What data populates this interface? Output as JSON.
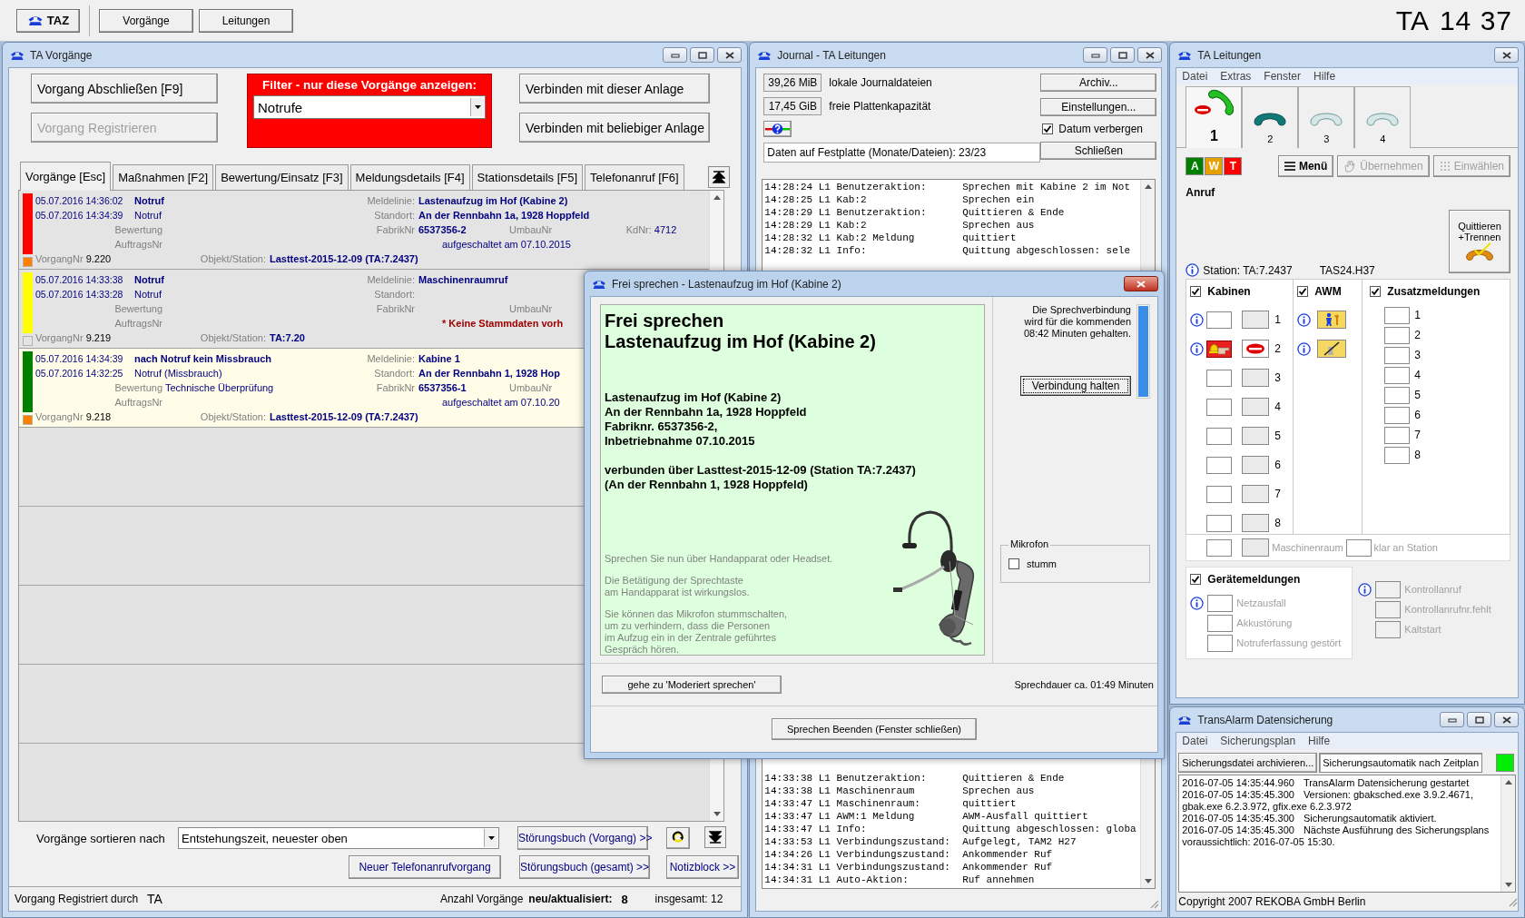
{
  "top_bar": {
    "app_button": "TAZ",
    "nav_buttons": [
      {
        "label": "Vorgänge"
      },
      {
        "label": "Leitungen"
      }
    ],
    "clock_label": "TA",
    "clock_time": "14 37"
  },
  "vorgaenge": {
    "title": "TA Vorgänge",
    "action_buttons": [
      {
        "label": "Vorgang Abschließen [F9]",
        "disabled": false
      },
      {
        "label": "Vorgang Registrieren",
        "disabled": true
      }
    ],
    "filter": {
      "title": "Filter - nur diese Vorgänge anzeigen:",
      "value": "Notrufe"
    },
    "connect_buttons": [
      {
        "label": "Verbinden mit dieser Anlage"
      },
      {
        "label": "Verbinden mit beliebiger Anlage"
      }
    ],
    "tabs": [
      {
        "label": "Vorgänge [Esc]",
        "selected": true
      },
      {
        "label": "Maßnahmen [F2]",
        "selected": false
      },
      {
        "label": "Bewertung/Einsatz [F3]",
        "selected": false
      },
      {
        "label": "Meldungsdetails [F4]",
        "selected": false
      },
      {
        "label": "Stationsdetails [F5]",
        "selected": false
      },
      {
        "label": "Telefonanruf [F6]",
        "selected": false
      }
    ],
    "rows": [
      {
        "color": "#ff0000",
        "marker": {
          "color": "#ff8000"
        },
        "selected": false,
        "time_1": "05.07.2016 14:36:02",
        "event_1": "Notruf",
        "time_2": "05.07.2016 14:34:39",
        "event_2": "Notruf",
        "bewertung_label": "Bewertung",
        "auftrag_label": "AuftragsNr",
        "vorgang_label": "VorgangNr",
        "vorgang": "9.220",
        "objekt_label": "Objekt/Station:",
        "objekt": "Lasttest-2015-12-09 (TA:7.2437)",
        "meldelinie_label": "Meldelinie:",
        "meldelinie": "Lastenaufzug im Hof (Kabine 2)",
        "standort_label": "Standort:",
        "standort": "An der Rennbahn 1a, 1928 Hoppfeld",
        "fabrik_label": "FabrikNr",
        "fabrik": "6537356-2",
        "umbau_label": "UmbauNr",
        "kd_label": "KdNr:",
        "kd": "4712",
        "aufgeschaltet": "aufgeschaltet am 07.10.2015"
      },
      {
        "color": "#ffff00",
        "marker": {
          "color": "#e4e4e4"
        },
        "selected": false,
        "time_1": "05.07.2016 14:33:38",
        "event_1": "Notruf",
        "time_2": "05.07.2016 14:33:28",
        "event_2": "Notruf",
        "bewertung_label": "Bewertung",
        "auftrag_label": "AuftragsNr",
        "vorgang_label": "VorgangNr",
        "vorgang": "9.219",
        "objekt_label": "Objekt/Station:",
        "objekt": "TA:7.20",
        "meldelinie_label": "Meldelinie:",
        "meldelinie": "Maschinenraumruf",
        "standort_label": "Standort:",
        "fabrik_label": "FabrikNr",
        "umbau_label": "UmbauNr",
        "note": "* Keine Stammdaten vorh"
      },
      {
        "color": "#008000",
        "marker": {
          "color": "#ff8000"
        },
        "selected": true,
        "time_1": "05.07.2016 14:34:39",
        "event_1": "nach Notruf kein Missbrauch",
        "time_2": "05.07.2016 14:32:25",
        "event_2": "Notruf (Missbrauch)",
        "bewertung_label": "Bewertung",
        "bewertung": "Technische Überprüfung",
        "auftrag_label": "AuftragsNr",
        "vorgang_label": "VorgangNr",
        "vorgang": "9.218",
        "objekt_label": "Objekt/Station:",
        "objekt": "Lasttest-2015-12-09 (TA:7.2437)",
        "meldelinie_label": "Meldelinie:",
        "meldelinie": "Kabine 1",
        "standort_label": "Standort:",
        "standort": "An der Rennbahn 1, 1928 Hop",
        "fabrik_label": "FabrikNr",
        "fabrik": "6537356-1",
        "umbau_label": "UmbauNr",
        "aufgeschaltet": "aufgeschaltet am 07.10.20"
      }
    ],
    "sort": {
      "label": "Vorgänge sortieren nach",
      "value": "Entstehungszeit, neuester oben"
    },
    "buttons": {
      "stoerungsbuch_vorgang": "Störungsbuch (Vorgang) >>",
      "neuer_anruf": "Neuer Telefonanrufvorgang",
      "stoerungsbuch_gesamt": "Störungsbuch (gesamt) >>",
      "notizblock": "Notizblock >>"
    },
    "status_bar": {
      "registered_label": "Vorgang Registriert durch",
      "registered_by": "TA",
      "count_label": "Anzahl Vorgänge",
      "new_label": "neu/aktualisiert:",
      "new_count": "8",
      "total": "insgesamt: 12"
    }
  },
  "journal": {
    "title": "Journal - TA Leitungen",
    "stats": [
      {
        "value": "39,26 MiB",
        "label": "lokale Journaldateien"
      },
      {
        "value": "17,45 GiB",
        "label": "freie Plattenkapazität"
      }
    ],
    "storage_info": "Daten auf Festplatte (Monate/Dateien): 23/23",
    "buttons": [
      "Archiv...",
      "Einstellungen..."
    ],
    "hide_date": {
      "label": "Datum verbergen",
      "checked": true
    },
    "close_button": "Schließen",
    "log_top": [
      {
        "entry": "14:28:24 L1 Benutzeraktion:",
        "detail": "Sprechen mit Kabine 2 im Not"
      },
      {
        "entry": "14:28:25 L1 Kab:2",
        "detail": "Sprechen ein"
      },
      {
        "entry": "14:28:29 L1 Benutzeraktion:",
        "detail": "Quittieren & Ende"
      },
      {
        "entry": "14:28:29 L1 Kab:2",
        "detail": "Sprechen aus"
      },
      {
        "entry": "14:28:32 L1 Kab:2 Meldung",
        "detail": "quittiert"
      },
      {
        "entry": "14:28:32 L1 Info:",
        "detail": "Quittung abgeschlossen: sele"
      }
    ],
    "log_bottom": [
      {
        "entry": "14:33:38 L1 Benutzeraktion:",
        "detail": "Quittieren & Ende"
      },
      {
        "entry": "14:33:38 L1 Maschinenraum",
        "detail": "Sprechen aus"
      },
      {
        "entry": "14:33:47 L1 Maschinenraum:",
        "detail": "quittiert"
      },
      {
        "entry": "14:33:47 L1 AWM:1 Meldung",
        "detail": "AWM-Ausfall quittiert"
      },
      {
        "entry": "14:33:47 L1 Info:",
        "detail": "Quittung abgeschlossen: globa"
      },
      {
        "entry": "14:33:53 L1 Verbindungszustand:",
        "detail": "Aufgelegt, TAM2 H27"
      },
      {
        "entry": "14:34:26 L1 Verbindungszustand:",
        "detail": "Ankommender Ruf"
      },
      {
        "entry": "14:34:31 L1 Verbindungszustand:",
        "detail": "Ankommender Ruf"
      },
      {
        "entry": "14:34:31 L1 Auto-Aktion:",
        "detail": "Ruf annehmen"
      }
    ]
  },
  "dialog": {
    "title": "Frei sprechen - Lastenaufzug im Hof (Kabine 2)",
    "heading": [
      "Frei sprechen",
      "Lastenaufzug im Hof (Kabine 2)"
    ],
    "details": [
      "Lastenaufzug im Hof (Kabine 2)",
      "An der Rennbahn 1a, 1928 Hoppfeld",
      "Fabriknr. 6537356-2,",
      "Inbetriebnahme 07.10.2015"
    ],
    "connection": [
      "verbunden über Lasttest-2015-12-09 (Station TA:7.2437)",
      "(An der Rennbahn 1, 1928 Hoppfeld)"
    ],
    "hints": [
      [
        "Sprechen Sie nun über Handapparat oder Headset."
      ],
      [
        "Die Betätigung der Sprechtaste",
        "am Handapparat ist wirkungslos."
      ],
      [
        "Sie können das Mikrofon stummschalten,",
        "um zu verhindern, dass die Personen",
        "im Aufzug ein in der Zentrale geführtes",
        "Gespräch hören."
      ]
    ],
    "hold": {
      "text": [
        "Die Sprechverbindung",
        "wird für die kommenden",
        "08:42 Minuten gehalten."
      ],
      "level": 1,
      "button": "Verbindung halten"
    },
    "microphone": {
      "title": "Mikrofon",
      "mute_label": "stumm",
      "muted": false
    },
    "moderated_button": "gehe zu 'Moderiert sprechen'",
    "duration": "Sprechdauer ca. 01:49 Minuten",
    "end_button": "Sprechen Beenden (Fenster schließen)"
  },
  "leitungen": {
    "title": "TA Leitungen",
    "menu": [
      "Datei",
      "Extras",
      "Fenster",
      "Hilfe"
    ],
    "lines": [
      {
        "number": "1",
        "kind": "talking",
        "selected": true
      },
      {
        "number": "2",
        "kind": "connected",
        "selected": false
      },
      {
        "number": "3",
        "kind": "idle",
        "selected": false
      },
      {
        "number": "4",
        "kind": "idle",
        "selected": false
      }
    ],
    "indicators": [
      {
        "letter": "A",
        "color": "#008000"
      },
      {
        "letter": "W",
        "color": "#e6a000"
      },
      {
        "letter": "T",
        "color": "#ff0000"
      }
    ],
    "buttons": [
      {
        "label": "Menü",
        "disabled": false,
        "kind": "menu"
      },
      {
        "label": "Übernehmen",
        "disabled": true,
        "kind": "take"
      },
      {
        "label": "Einwählen",
        "disabled": true,
        "kind": "dial"
      }
    ],
    "call_state": "Anruf",
    "ack_button": [
      "Quittieren",
      "+Trennen"
    ],
    "station": "Station: TA:7.2437",
    "device": "TAS24.H37",
    "kabinen": {
      "title": "Kabinen",
      "checked": true,
      "items": [
        {
          "number": "1",
          "info": true,
          "alarm": false,
          "talking": false
        },
        {
          "number": "2",
          "info": true,
          "alarm": true,
          "talking": true
        },
        {
          "number": "3",
          "info": false,
          "alarm": false,
          "talking": false
        },
        {
          "number": "4",
          "info": false,
          "alarm": false,
          "talking": false
        },
        {
          "number": "5",
          "info": false,
          "alarm": false,
          "talking": false
        },
        {
          "number": "6",
          "info": false,
          "alarm": false,
          "talking": false
        },
        {
          "number": "7",
          "info": false,
          "alarm": false,
          "talking": false
        },
        {
          "number": "8",
          "info": false,
          "alarm": false,
          "talking": false
        }
      ]
    },
    "awm": {
      "title": "AWM",
      "checked": true,
      "items": [
        {
          "kind": "present",
          "info": true
        },
        {
          "kind": "absent",
          "info": true
        }
      ]
    },
    "zusatz": {
      "title": "Zusatzmeldungen",
      "checked": true,
      "items": [
        "1",
        "2",
        "3",
        "4",
        "5",
        "6",
        "7",
        "8"
      ]
    },
    "maschinenraum": {
      "label": "Maschinenraum",
      "disabled": true
    },
    "klar": {
      "label": "klar an Station",
      "disabled": true
    },
    "geraete": {
      "title": "Gerätemeldungen",
      "checked": true,
      "items": [
        {
          "label": "Netzausfall",
          "info": true,
          "disabled": true
        },
        {
          "label": "Akkustörung",
          "info": false,
          "disabled": true
        },
        {
          "label": "Notruferfassung gestört",
          "info": false,
          "disabled": true
        }
      ]
    },
    "kontroll": [
      {
        "label": "Kontrollanruf",
        "info": true,
        "disabled": true
      },
      {
        "label": "Kontrollanrufnr.fehlt",
        "info": false,
        "disabled": true
      },
      {
        "label": "Kaltstart",
        "info": false,
        "disabled": true
      }
    ]
  },
  "datensicherung": {
    "title": "TransAlarm Datensicherung",
    "menu": [
      "Datei",
      "Sicherungsplan",
      "Hilfe"
    ],
    "buttons": [
      {
        "label": "Sicherungsdatei archivieren...",
        "pressed": false
      },
      {
        "label": "Sicherungsautomatik nach Zeitplan",
        "pressed": true
      }
    ],
    "automatic_on": true,
    "log": [
      {
        "time": "2016-07-05 14:35:44.960",
        "text": "TransAlarm Datensicherung gestartet"
      },
      {
        "time": "2016-07-05 14:35:45.300",
        "text": "Versionen: gbaksched.exe 3.9.2.4671, gbak.exe 6.2.3.972, gfix.exe 6.2.3.972"
      },
      {
        "time": "2016-07-05 14:35:45.300",
        "text": "Sicherungsautomatik aktiviert."
      },
      {
        "time": "2016-07-05 14:35:45.300",
        "text": "Nächste Ausführung des Sicherungsplans voraussichtlich: 2016-07-05 15:30."
      }
    ],
    "copyright": "Copyright 2007 REKOBA GmbH Berlin"
  }
}
